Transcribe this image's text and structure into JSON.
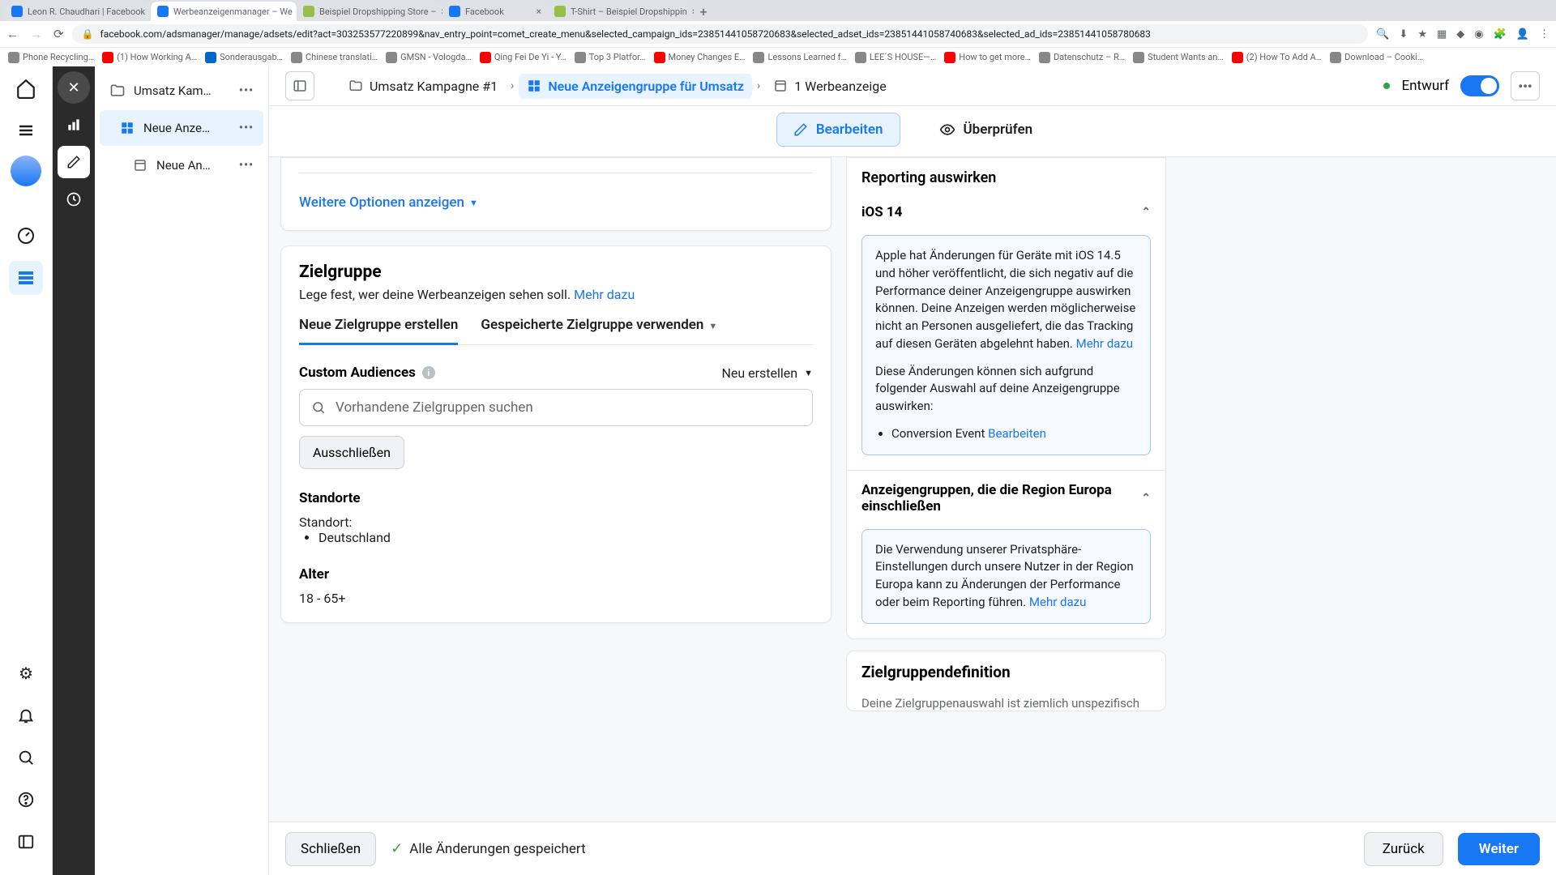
{
  "browser": {
    "tabs": [
      {
        "label": "Leon R. Chaudhari | Facebook"
      },
      {
        "label": "Werbeanzeigenmanager – We",
        "active": true
      },
      {
        "label": "Beispiel Dropshipping Store –"
      },
      {
        "label": "Facebook"
      },
      {
        "label": "T-Shirt – Beispiel Dropshippin"
      }
    ],
    "url": "facebook.com/adsmanager/manage/adsets/edit?act=303253577220899&nav_entry_point=comet_create_menu&selected_campaign_ids=23851441058720683&selected_adset_ids=23851441058740683&selected_ad_ids=23851441058780683",
    "bookmarks": [
      "Phone Recycling…",
      "(1) How Working A…",
      "Sonderausgab…",
      "Chinese translati…",
      "GMSN - Vologda…",
      "Qing Fei De Yi - Y…",
      "Top 3 Platfor…",
      "Money Changes E…",
      "Lessons Learned f…",
      "LEE´S HOUSE—…",
      "How to get more…",
      "Datenschutz – R…",
      "Student Wants an…",
      "(2) How To Add A…",
      "Download – Cooki…"
    ]
  },
  "tree": {
    "items": [
      {
        "label": "Umsatz Kam…",
        "icon": "folder"
      },
      {
        "label": "Neue Anze…",
        "icon": "grid",
        "active": true
      },
      {
        "label": "Neue An…",
        "icon": "ad"
      }
    ]
  },
  "topbar": {
    "campaign": "Umsatz Kampagne #1",
    "adset": "Neue Anzeigengruppe für Umsatz",
    "ad": "1 Werbeanzeige",
    "status": "Entwurf"
  },
  "tabs": {
    "edit": "Bearbeiten",
    "review": "Überprüfen"
  },
  "editor": {
    "more_options": "Weitere Optionen anzeigen",
    "section_title": "Zielgruppe",
    "section_sub": "Lege fest, wer deine Werbeanzeigen sehen soll. ",
    "section_link": "Mehr dazu",
    "tab_new": "Neue Zielgruppe erstellen",
    "tab_saved": "Gespeicherte Zielgruppe verwenden",
    "custom_label": "Custom Audiences",
    "create_new": "Neu erstellen",
    "search_placeholder": "Vorhandene Zielgruppen suchen",
    "exclude": "Ausschließen",
    "locations_label": "Standorte",
    "location_line": "Standort:",
    "location_value": "Deutschland",
    "age_label": "Alter",
    "age_value": "18 - 65+"
  },
  "side": {
    "reporting_head": "Reporting auswirken",
    "ios_title": "iOS 14",
    "ios_body1": "Apple hat Änderungen für Geräte mit iOS 14.5 und höher veröffentlicht, die sich negativ auf die Performance deiner Anzeigengruppe auswirken können. Deine Anzeigen werden möglicherweise nicht an Personen ausgeliefert, die das Tracking auf diesen Geräten abgelehnt haben. ",
    "ios_more": "Mehr dazu",
    "ios_body2": "Diese Änderungen können sich aufgrund folgender Auswahl auf deine Anzeigengruppe auswirken:",
    "ios_li_prefix": "Conversion Event ",
    "ios_li_link": "Bearbeiten",
    "eu_title": "Anzeigengruppen, die die Region Europa einschließen",
    "eu_body": "Die Verwendung unserer Privatsphäre-Einstellungen durch unsere Nutzer in der Region Europa kann zu Änderungen der Performance oder beim Reporting führen. ",
    "eu_more": "Mehr dazu",
    "def_title": "Zielgruppendefinition",
    "def_body": "Deine Zielgruppenauswahl ist ziemlich unspezifisch"
  },
  "footer": {
    "close": "Schließen",
    "saved": "Alle Änderungen gespeichert",
    "back": "Zurück",
    "next": "Weiter"
  }
}
